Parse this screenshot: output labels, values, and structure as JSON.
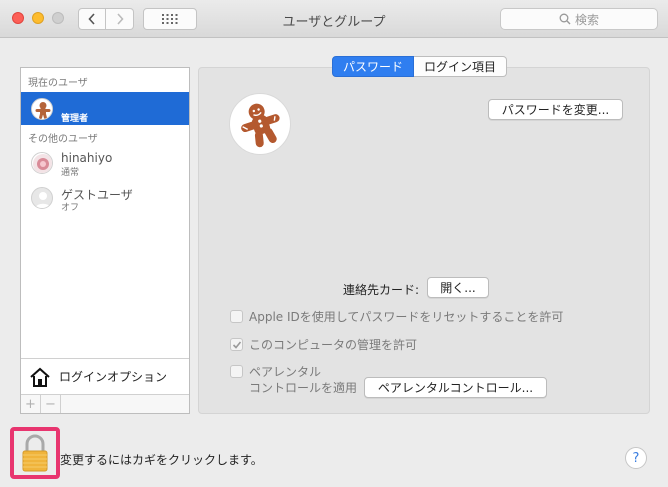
{
  "window": {
    "title": "ユーザとグループ"
  },
  "toolbar": {
    "search_placeholder": "検索"
  },
  "sidebar": {
    "current_users_header": "現在のユーザ",
    "current_user": {
      "role": "管理者"
    },
    "other_users_header": "その他のユーザ",
    "other_users": [
      {
        "name": "hinahiyo",
        "role": "通常"
      },
      {
        "name": "ゲストユーザ",
        "role": "オフ"
      }
    ],
    "login_options_label": "ログインオプション",
    "add_label": "+",
    "remove_label": "−"
  },
  "tabs": [
    {
      "label": "パスワード",
      "active": true
    },
    {
      "label": "ログイン項目",
      "active": false
    }
  ],
  "panel": {
    "change_password_button": "パスワードを変更...",
    "contact_card_label": "連絡先カード:",
    "open_button": "開く...",
    "options": [
      {
        "label": "Apple IDを使用してパスワードをリセットすることを許可",
        "checked": false
      },
      {
        "label": "このコンピュータの管理を許可",
        "checked": true
      }
    ],
    "parental_label_line1": "ペアレンタル",
    "parental_label_line2": "コントロールを適用",
    "parental_checked": false,
    "parental_controls_button": "ペアレンタルコントロール..."
  },
  "footer": {
    "lock_text": "変更するにはカギをクリックします。",
    "help_label": "?"
  },
  "colors": {
    "selection": "#1f6bd6",
    "active_tab": "#2f7ef0",
    "lock_highlight": "#e8356f"
  }
}
